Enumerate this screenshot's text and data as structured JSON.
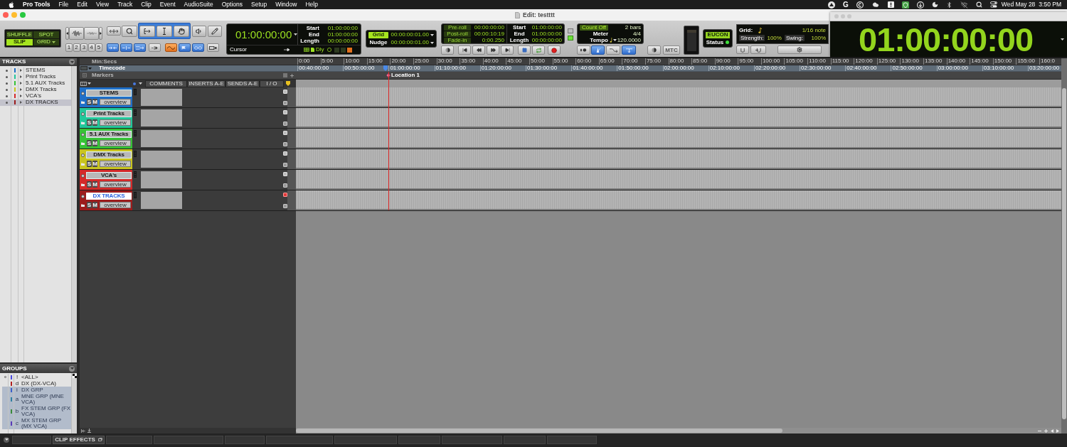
{
  "menu_bar": {
    "items": [
      {
        "label": "Pro Tools",
        "kind": "app"
      },
      {
        "label": "File",
        "kind": "menu"
      },
      {
        "label": "Edit",
        "kind": "menu"
      },
      {
        "label": "View",
        "kind": "menu"
      },
      {
        "label": "Track",
        "kind": "menu"
      },
      {
        "label": "Clip",
        "kind": "menu"
      },
      {
        "label": "Event",
        "kind": "menu"
      },
      {
        "label": "AudioSuite",
        "kind": "menu"
      },
      {
        "label": "Options",
        "kind": "menu"
      },
      {
        "label": "Setup",
        "kind": "menu"
      },
      {
        "label": "Window",
        "kind": "menu"
      },
      {
        "label": "Help",
        "kind": "menu"
      }
    ],
    "status_letter": "G",
    "date": "Wed May 28",
    "time": "3:50 PM"
  },
  "window": {
    "title": "Edit: testttt"
  },
  "toolbar": {
    "edit_modes": [
      {
        "label": "SHUFFLE",
        "kind": "toggle",
        "selected": false
      },
      {
        "label": "SPOT",
        "kind": "toggle",
        "selected": false
      },
      {
        "label": "SLIP",
        "kind": "toggle",
        "selected": true
      },
      {
        "label": "GRID",
        "kind": "dropdown",
        "selected": false
      }
    ],
    "zoom_presets": [
      "1",
      "2",
      "3",
      "4",
      "5"
    ],
    "smart_tool": {
      "on": true
    },
    "main_counter": {
      "value": "01:00:00:00",
      "sub_label": "Cursor",
      "fields": [
        {
          "label": "Start",
          "value": "01:00:00:00"
        },
        {
          "label": "End",
          "value": "01:00:00:00"
        },
        {
          "label": "Length",
          "value": "00:00:00:00"
        }
      ],
      "delay_label": "Dly"
    },
    "grid_nudge": [
      {
        "label": "Grid",
        "value": "00:00:00:01.00",
        "selected": true
      },
      {
        "label": "Nudge",
        "value": "00:00:00:01.00",
        "selected": false
      }
    ],
    "transport_display": {
      "rolls": [
        {
          "label": "Pre-roll",
          "value": "00:00:00:00",
          "on": false
        },
        {
          "label": "Post-roll",
          "value": "00:00:10:19",
          "on": false
        },
        {
          "label": "Fade-in",
          "value": "0:00.250",
          "on": false
        }
      ],
      "selection": [
        {
          "label": "Start",
          "value": "01:00:00:00"
        },
        {
          "label": "End",
          "value": "01:00:00:00"
        },
        {
          "label": "Length",
          "value": "00:00:00:00"
        }
      ]
    },
    "midi_display": [
      {
        "label": "Count Off",
        "value": "2 bars",
        "kind": "toggle",
        "on": true
      },
      {
        "label": "Meter",
        "value": "4/4",
        "kind": "plain"
      },
      {
        "label": "Tempo",
        "value": "120.0000",
        "kind": "tempo"
      }
    ],
    "sync_button": "MTC",
    "eucon": {
      "label": "EUCON",
      "status_label": "Status",
      "on": true
    },
    "grid_quantize": {
      "grid_label": "Grid:",
      "grid_value": "1/16 note",
      "strength_label": "Strength:",
      "strength_value": "100%",
      "swing_label": "Swing:",
      "swing_value": "100%"
    }
  },
  "big_counter": {
    "value": "01:00:00:00"
  },
  "tracks_panel": {
    "title": "TRACKS",
    "items": [
      {
        "name": "STEMS",
        "color": "#1f6fc8",
        "selected": false
      },
      {
        "name": "Print Tracks",
        "color": "#22c79a",
        "selected": false
      },
      {
        "name": "5.1 AUX Tracks",
        "color": "#36c236",
        "selected": false
      },
      {
        "name": "DMX Tracks",
        "color": "#c9c41f",
        "selected": false
      },
      {
        "name": "VCA's",
        "color": "#d42a2a",
        "selected": false
      },
      {
        "name": "DX TRACKS",
        "color": "#9c1c1c",
        "selected": true
      }
    ]
  },
  "groups_panel": {
    "title": "GROUPS",
    "items": [
      {
        "id": "!",
        "name": "<ALL>",
        "color": "#4a4ae0",
        "active": true,
        "selected": false
      },
      {
        "id": "d",
        "name": "DX (DX-VCA)",
        "color": "#b02020",
        "active": false,
        "selected": false
      },
      {
        "id": "i",
        "name": "DX GRP",
        "color": "#3a5fc8",
        "active": false,
        "selected": true
      },
      {
        "id": "a",
        "name": "MNE GRP (MNE VCA)",
        "color": "#2f7f9f",
        "active": false,
        "selected": true
      },
      {
        "id": "b",
        "name": "FX STEM GRP (FX VCA)",
        "color": "#3a8a3a",
        "active": false,
        "selected": true
      },
      {
        "id": "c",
        "name": "MX STEM GRP (MX VCA)",
        "color": "#5a3ab8",
        "active": false,
        "selected": true
      }
    ]
  },
  "rulers": [
    {
      "label": "Min:Secs",
      "kind": "minsecs",
      "ticks": [
        "0:00",
        "5:00",
        "10:00",
        "15:00",
        "20:00",
        "25:00",
        "30:00",
        "35:00",
        "40:00",
        "45:00",
        "50:00",
        "55:00",
        "60:00",
        "65:00",
        "70:00",
        "75:00",
        "80:00",
        "85:00",
        "90:00",
        "95:00",
        "100:00",
        "105:00",
        "110:00",
        "115:00",
        "120:00",
        "125:00",
        "130:00",
        "135:00",
        "140:00",
        "145:00",
        "150:00",
        "155:00",
        "160:0"
      ]
    },
    {
      "label": "Timecode",
      "kind": "timecode",
      "ticks": [
        "00:40:00:00",
        "00:50:00:00",
        "01:00:00:00",
        "01:10:00:00",
        "01:20:00:00",
        "01:30:00:00",
        "01:40:00:00",
        "01:50:00:00",
        "02:00:00:00",
        "02:10:00:00",
        "02:20:00:00",
        "02:30:00:00",
        "02:40:00:00",
        "02:50:00:00",
        "03:00:00:00",
        "03:10:00:00",
        "03:20:00:00"
      ]
    },
    {
      "label": "Markers",
      "kind": "markers",
      "markers": [
        "Location 1"
      ]
    }
  ],
  "columns": [
    "COMMENTS",
    "INSERTS A-E",
    "SENDS A-E",
    "I / O"
  ],
  "tracks": [
    {
      "name": "STEMS",
      "color": "#1f6fc8",
      "selected": false,
      "indicator_on": false,
      "solo": "S",
      "mute": "M",
      "view": "overview"
    },
    {
      "name": "Print Tracks",
      "color": "#22c79a",
      "selected": false,
      "indicator_on": false,
      "solo": "S",
      "mute": "M",
      "view": "overview"
    },
    {
      "name": "5.1 AUX Tracks",
      "color": "#36c236",
      "selected": false,
      "indicator_on": false,
      "solo": "S",
      "mute": "M",
      "view": "overview"
    },
    {
      "name": "DMX Tracks",
      "color": "#c9c41f",
      "selected": false,
      "indicator_on": false,
      "solo": "S",
      "mute": "M",
      "view": "overview"
    },
    {
      "name": "VCA's",
      "color": "#d42a2a",
      "selected": false,
      "indicator_on": false,
      "solo": "S",
      "mute": "M",
      "view": "overview"
    },
    {
      "name": "DX TRACKS",
      "color": "#9c1c1c",
      "selected": true,
      "indicator_on": true,
      "solo": "S",
      "mute": "M",
      "view": "overview"
    }
  ],
  "bottom_tabs": [
    {
      "label": "CLIP EFFECTS"
    }
  ]
}
